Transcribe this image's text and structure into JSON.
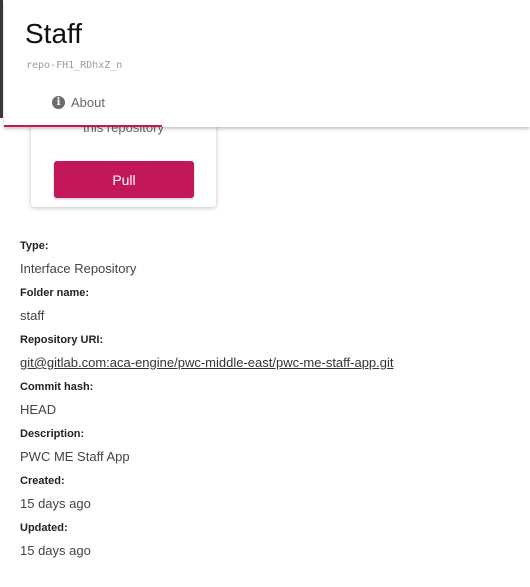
{
  "header": {
    "title": "Staff",
    "subtitle": "repo-FH1_RDhxZ_n",
    "tabs": [
      {
        "label": "About",
        "icon": "info-icon",
        "active": true
      }
    ],
    "accent_color": "#c2185b"
  },
  "card": {
    "partial_text": "this repository",
    "pull_label": "Pull"
  },
  "details": [
    {
      "label": "Type:",
      "value": "Interface Repository"
    },
    {
      "label": "Folder name:",
      "value": "staff"
    },
    {
      "label": "Repository URI:",
      "value": "git@gitlab.com:aca-engine/pwc-middle-east/pwc-me-staff-app.git"
    },
    {
      "label": "Commit hash:",
      "value": "HEAD"
    },
    {
      "label": "Description:",
      "value": "PWC ME Staff App"
    },
    {
      "label": "Created:",
      "value": "15 days ago"
    },
    {
      "label": "Updated:",
      "value": "15 days ago"
    }
  ]
}
